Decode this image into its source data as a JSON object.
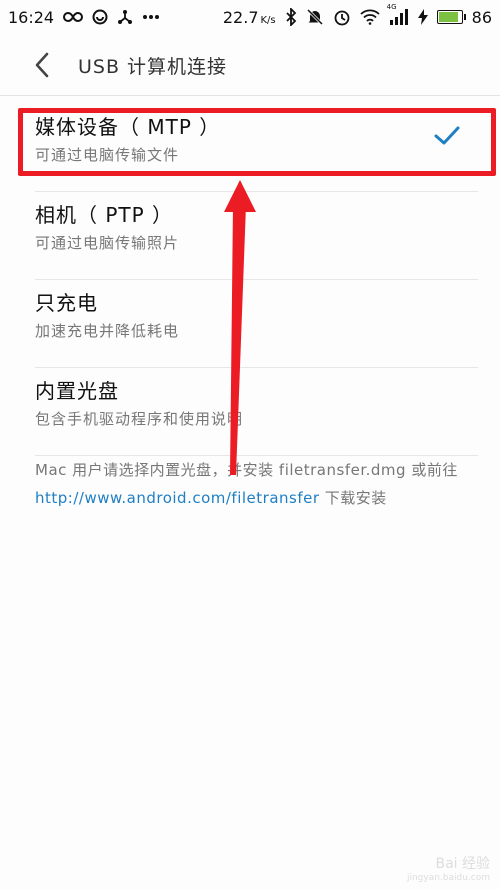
{
  "status_bar": {
    "time": "16:24",
    "speed_value": "22.7",
    "speed_unit": "K/s",
    "network_label": "4G",
    "battery": "86",
    "battery_level": 0.86,
    "icons": [
      "infinity-icon",
      "app-icon",
      "share-icon",
      "more-dots-icon",
      "bluetooth-icon",
      "mute-icon",
      "alarm-icon",
      "wifi-icon",
      "signal-icon",
      "charging-icon",
      "battery-icon"
    ]
  },
  "header": {
    "title": "USB 计算机连接"
  },
  "options": [
    {
      "title": "媒体设备（ MTP ）",
      "desc": "可通过电脑传输文件",
      "selected": true
    },
    {
      "title": "相机（ PTP ）",
      "desc": "可通过电脑传输照片",
      "selected": false
    },
    {
      "title": "只充电",
      "desc": "加速充电并降低耗电",
      "selected": false
    },
    {
      "title": "内置光盘",
      "desc": "包含手机驱动程序和使用说明",
      "selected": false
    }
  ],
  "note": {
    "before": "Mac 用户请选择内置光盘，并安装 filetransfer.dmg 或前往 ",
    "link": "http://www.android.com/filetransfer",
    "after": " 下载安装"
  },
  "colors": {
    "accent": "#1e7fc4",
    "highlight": "#ec1c24",
    "battery": "#7dc142"
  },
  "watermark": {
    "brand": "Bai 经验",
    "url": "jingyan.baidu.com"
  }
}
